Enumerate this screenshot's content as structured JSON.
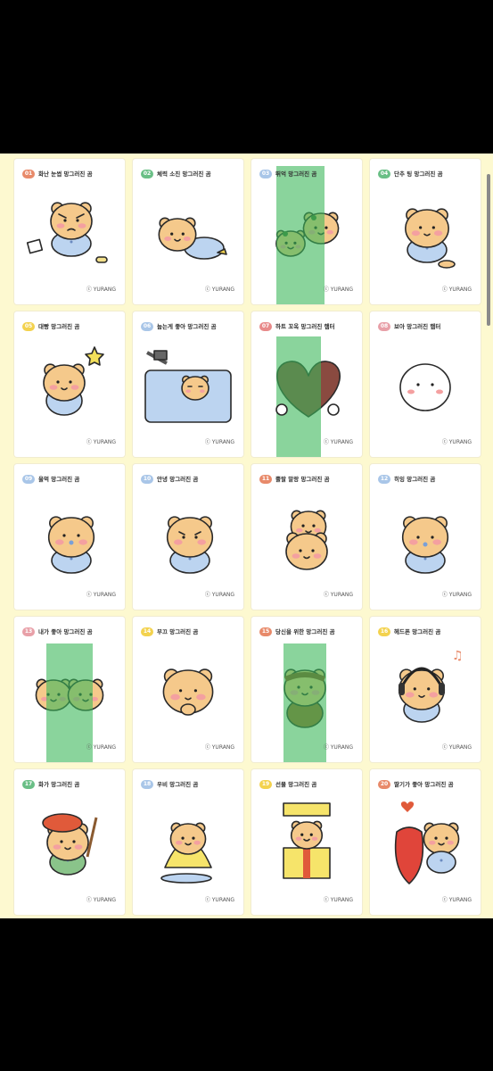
{
  "sheet_credit": "ⓒ YURANG",
  "cards": [
    {
      "num": "01",
      "title": "화난 눈썹 망그러진 곰",
      "badge_color": "#e88a6a",
      "art": "angry"
    },
    {
      "num": "02",
      "title": "체력 소진 망그러진 곰",
      "badge_color": "#6abf86",
      "art": "tired"
    },
    {
      "num": "03",
      "title": "뛰억 망그러진 곰",
      "badge_color": "#a9c6e8",
      "art": "frog"
    },
    {
      "num": "04",
      "title": "단추 팅 망그러진 곰",
      "badge_color": "#6abf86",
      "art": "button"
    },
    {
      "num": "05",
      "title": "대빵 망그러진 곰",
      "badge_color": "#f3d24e",
      "art": "star"
    },
    {
      "num": "06",
      "title": "눕는게 좋아 망그러진 곰",
      "badge_color": "#a9c6e8",
      "art": "sleep"
    },
    {
      "num": "07",
      "title": "하트 꼬옥 망그러진 햄터",
      "badge_color": "#e88a8a",
      "art": "heart"
    },
    {
      "num": "08",
      "title": "보아 망그러진 햄터",
      "badge_color": "#e8a0a8",
      "art": "ghost"
    },
    {
      "num": "09",
      "title": "울먹 망그러진 곰",
      "badge_color": "#a9c6e8",
      "art": "cry"
    },
    {
      "num": "10",
      "title": "안녕 망그러진 곰",
      "badge_color": "#a9c6e8",
      "art": "hello"
    },
    {
      "num": "11",
      "title": "뿔랄 말랑 망그러진 곰",
      "badge_color": "#e88a6a",
      "art": "stack"
    },
    {
      "num": "12",
      "title": "히잉 망그러진 곰",
      "badge_color": "#a9c6e8",
      "art": "sad"
    },
    {
      "num": "13",
      "title": "내가 좋아 망그러진 곰",
      "badge_color": "#e8a0a8",
      "art": "hug"
    },
    {
      "num": "14",
      "title": "부끄 망그러진 곰",
      "badge_color": "#f3d24e",
      "art": "shy"
    },
    {
      "num": "15",
      "title": "당신을 위한 망그러진 곰",
      "badge_color": "#e88a6a",
      "art": "mummy"
    },
    {
      "num": "16",
      "title": "헤드폰 망그러진 곰",
      "badge_color": "#f3d24e",
      "art": "music"
    },
    {
      "num": "17",
      "title": "화가 망그러진 곰",
      "badge_color": "#6abf86",
      "art": "painter"
    },
    {
      "num": "18",
      "title": "우비 망그러진 곰",
      "badge_color": "#a9c6e8",
      "art": "raincoat"
    },
    {
      "num": "19",
      "title": "선물 망그러진 곰",
      "badge_color": "#f3d24e",
      "art": "gift"
    },
    {
      "num": "20",
      "title": "딸기가 좋아 망그러진 곰",
      "badge_color": "#e88a6a",
      "art": "strawberry"
    }
  ]
}
